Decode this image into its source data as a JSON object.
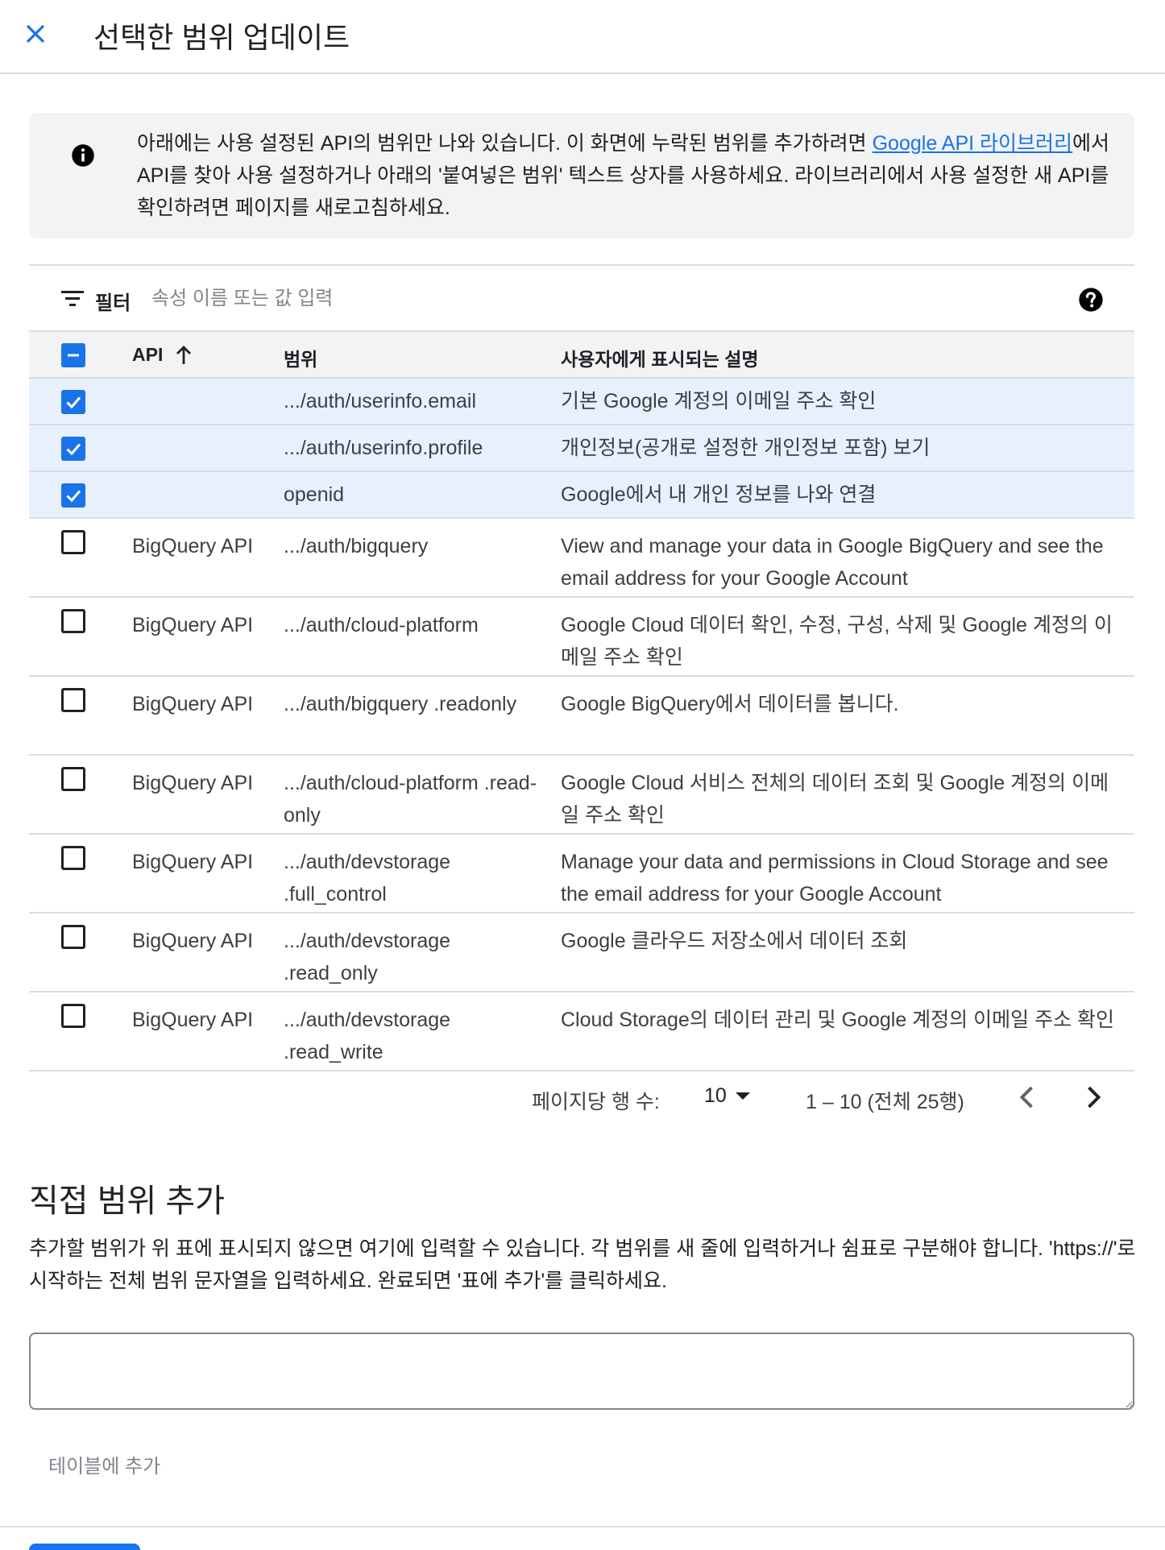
{
  "header": {
    "title": "선택한 범위 업데이트",
    "close_icon": "close-icon"
  },
  "info": {
    "text_before": "아래에는 사용 설정된 API의 범위만 나와 있습니다. 이 화면에 누락된 범위를 추가하려면 ",
    "link_label": "Google API 라이브러리",
    "text_after": "에서 API를 찾아 사용 설정하거나 아래의 '붙여넣은 범위' 텍스트 상자를 사용하세요. 라이브러리에서 사용 설정한 새 API를 확인하려면 페이지를 새로고침하세요."
  },
  "filter": {
    "label": "필터",
    "placeholder": "속성 이름 또는 값 입력"
  },
  "table": {
    "columns": {
      "api": "API",
      "scope": "범위",
      "desc": "사용자에게 표시되는 설명"
    },
    "rows": [
      {
        "checked": true,
        "api": "",
        "scope": ".../auth/userinfo.email",
        "desc": "기본 Google 계정의 이메일 주소 확인"
      },
      {
        "checked": true,
        "api": "",
        "scope": ".../auth/userinfo.profile",
        "desc": "개인정보(공개로 설정한 개인정보 포함) 보기"
      },
      {
        "checked": true,
        "api": "",
        "scope": "openid",
        "desc": "Google에서 내 개인 정보를 나와 연결"
      },
      {
        "checked": false,
        "api": "BigQuery API",
        "scope": ".../auth/bigquery",
        "desc": "View and manage your data in Google BigQuery and see the email address for your Google Account"
      },
      {
        "checked": false,
        "api": "BigQuery API",
        "scope": ".../auth/cloud-platform",
        "desc": "Google Cloud 데이터 확인, 수정, 구성, 삭제 및 Google 계정의 이메일 주소 확인"
      },
      {
        "checked": false,
        "api": "BigQuery API",
        "scope": ".../auth/bigquery .readonly",
        "desc": "Google BigQuery에서 데이터를 봅니다."
      },
      {
        "checked": false,
        "api": "BigQuery API",
        "scope": ".../auth/cloud-platform .read-only",
        "desc": "Google Cloud 서비스 전체의 데이터 조회 및 Google 계정의 이메일 주소 확인"
      },
      {
        "checked": false,
        "api": "BigQuery API",
        "scope": ".../auth/devstorage .full_control",
        "desc": "Manage your data and permissions in Cloud Storage and see the email address for your Google Account"
      },
      {
        "checked": false,
        "api": "BigQuery API",
        "scope": ".../auth/devstorage .read_only",
        "desc": "Google 클라우드 저장소에서 데이터 조회"
      },
      {
        "checked": false,
        "api": "BigQuery API",
        "scope": ".../auth/devstorage .read_write",
        "desc": "Cloud Storage의 데이터 관리 및 Google 계정의 이메일 주소 확인"
      }
    ]
  },
  "pagination": {
    "rows_label": "페이지당 행 수:",
    "rows_value": "10",
    "range": "1 – 10 (전체 25행)"
  },
  "manual": {
    "title": "직접 범위 추가",
    "description": "추가할 범위가 위 표에 표시되지 않으면 여기에 입력할 수 있습니다. 각 범위를 새 줄에 입력하거나 쉼표로 구분해야 합니다. 'https://'로 시작하는 전체 범위 문자열을 입력하세요. 완료되면 '표에 추가'를 클릭하세요.",
    "textarea_value": "",
    "add_button": "테이블에 추가"
  },
  "colors": {
    "accent": "#1a73e8",
    "selected_row": "#e8f0fe",
    "info_bg": "#f1f3f4"
  }
}
